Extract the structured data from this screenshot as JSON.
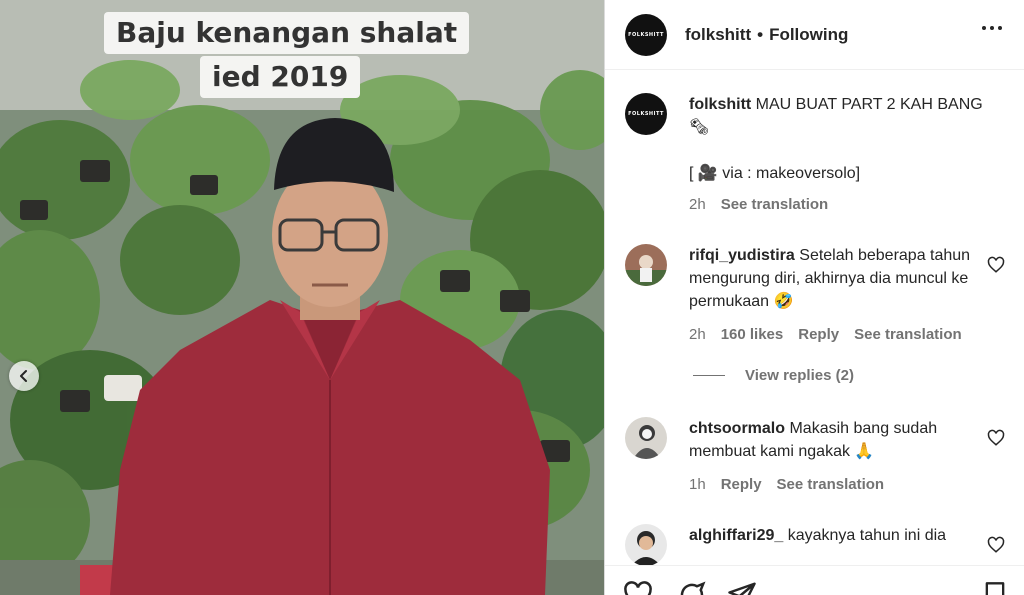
{
  "media": {
    "caption_line_1": "Baju kenangan shalat",
    "caption_line_2": "ied 2019"
  },
  "header": {
    "avatar_text": "FOLKSHITT",
    "username": "folkshitt",
    "separator": "•",
    "follow_status": "Following"
  },
  "caption": {
    "avatar_text": "FOLKSHITT",
    "username": "folkshitt",
    "text": "MAU BUAT PART 2 KAH BANG 🗞",
    "credit": "[ 🎥 via : makeoversolo]",
    "time": "2h",
    "see_translation": "See translation"
  },
  "comments": [
    {
      "username": "rifqi_yudistira",
      "text": "Setelah beberapa tahun mengurung diri, akhirnya dia muncul ke permukaan 🤣",
      "time": "2h",
      "likes": "160 likes",
      "reply": "Reply",
      "see_translation": "See translation",
      "view_replies": "View replies (2)"
    },
    {
      "username": "chtsoormalo",
      "text": "Makasih bang sudah membuat kami ngakak 🙏",
      "time": "1h",
      "reply": "Reply",
      "see_translation": "See translation"
    },
    {
      "username": "alghiffari29_",
      "text": "kayaknya tahun ini dia"
    }
  ],
  "icons": [
    "chevron-left-icon",
    "more-icon",
    "heart-icon",
    "comment-icon",
    "share-icon",
    "bookmark-icon"
  ],
  "colors": {
    "text": "#262626",
    "secondary": "#737373",
    "shirt": "#9e2c3c",
    "border": "#dbdbdb"
  }
}
